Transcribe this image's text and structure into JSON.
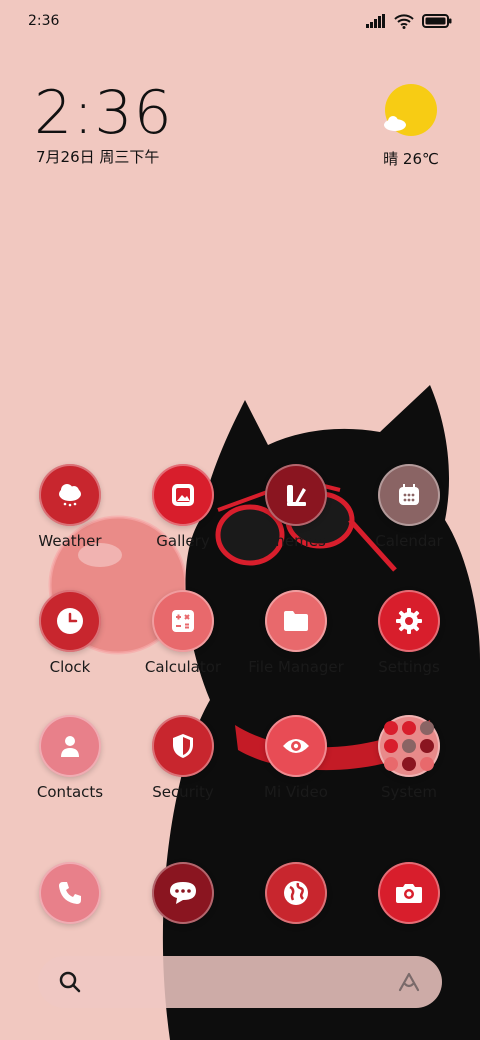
{
  "status": {
    "time": "2:36"
  },
  "lockscreen_clock": {
    "time": "2:36",
    "date": "7月26日 周三下午"
  },
  "weather_widget": {
    "text": "晴 26℃"
  },
  "colors": {
    "accent_red": "#d81e2c",
    "dark_red": "#8a1520",
    "pink": "#e88a8a",
    "background": "#f1c8c0"
  },
  "apps_row1": [
    {
      "label": "Weather",
      "icon": "cloud-icon"
    },
    {
      "label": "Gallery",
      "icon": "image-icon"
    },
    {
      "label": "Themes",
      "icon": "brush-icon"
    },
    {
      "label": "Calendar",
      "icon": "calendar-icon"
    }
  ],
  "apps_row2": [
    {
      "label": "Clock",
      "icon": "clock-icon"
    },
    {
      "label": "Calculator",
      "icon": "calculator-icon"
    },
    {
      "label": "File Manager",
      "icon": "folder-icon"
    },
    {
      "label": "Settings",
      "icon": "gear-icon"
    }
  ],
  "apps_row3": [
    {
      "label": "Contacts",
      "icon": "person-icon"
    },
    {
      "label": "Security",
      "icon": "shield-icon"
    },
    {
      "label": "Mi Video",
      "icon": "eye-icon"
    },
    {
      "label": "System",
      "icon": "folder-grid-icon"
    }
  ],
  "dock": [
    {
      "icon": "phone-icon"
    },
    {
      "icon": "message-icon"
    },
    {
      "icon": "browser-icon"
    },
    {
      "icon": "camera-icon"
    }
  ]
}
